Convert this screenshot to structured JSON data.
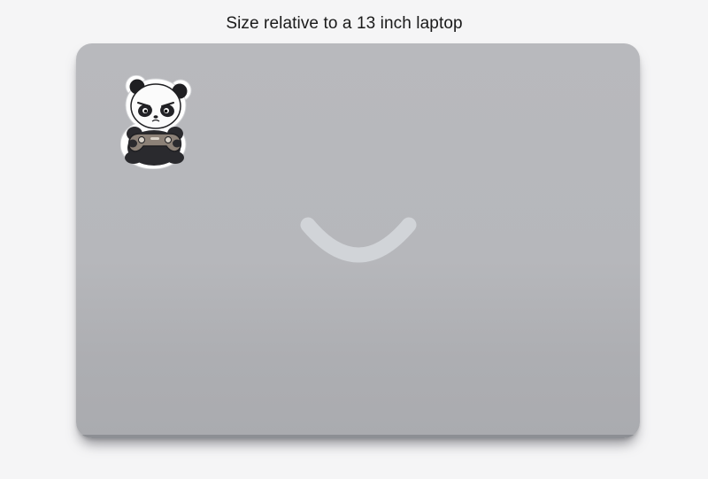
{
  "caption": "Size relative to a 13 inch laptop",
  "colors": {
    "lid": "#b7b8bc",
    "logo": "#d1d4d8",
    "background": "#f5f5f6"
  },
  "icons": {
    "logo": "smile-arc-icon",
    "sticker": "panda-gamer-sticker"
  }
}
